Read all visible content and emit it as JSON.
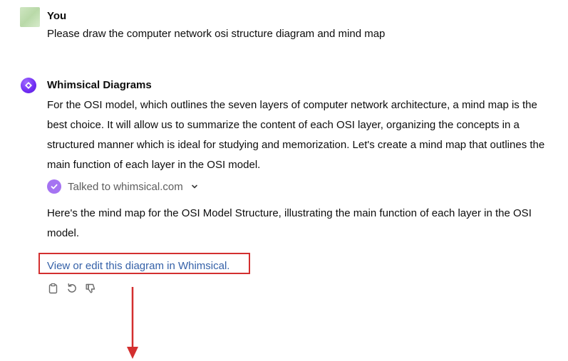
{
  "user": {
    "name": "You",
    "message": "Please draw the computer network osi structure diagram and mind map"
  },
  "assistant": {
    "name": "Whimsical Diagrams",
    "intro": "For the OSI model, which outlines the seven layers of computer network architecture, a mind map is the best choice. It will allow us to summarize the content of each OSI layer, organizing the concepts in a structured manner which is ideal for studying and memorization. Let's create a mind map that outlines the main function of each layer in the OSI model.",
    "tool_status": "Talked to whimsical.com",
    "result": "Here's the mind map for the OSI Model Structure, illustrating the main function of each layer in the OSI model.",
    "link_text": "View or edit this diagram in Whimsical."
  },
  "actions": {
    "icons": [
      "clipboard-icon",
      "regenerate-icon",
      "thumbs-down-icon"
    ]
  },
  "colors": {
    "link": "#3561a8",
    "highlight_box": "#d32f2f",
    "arrow": "#d32f2f",
    "brand": "#6f2cf3",
    "tool_check": "#a573f2"
  }
}
